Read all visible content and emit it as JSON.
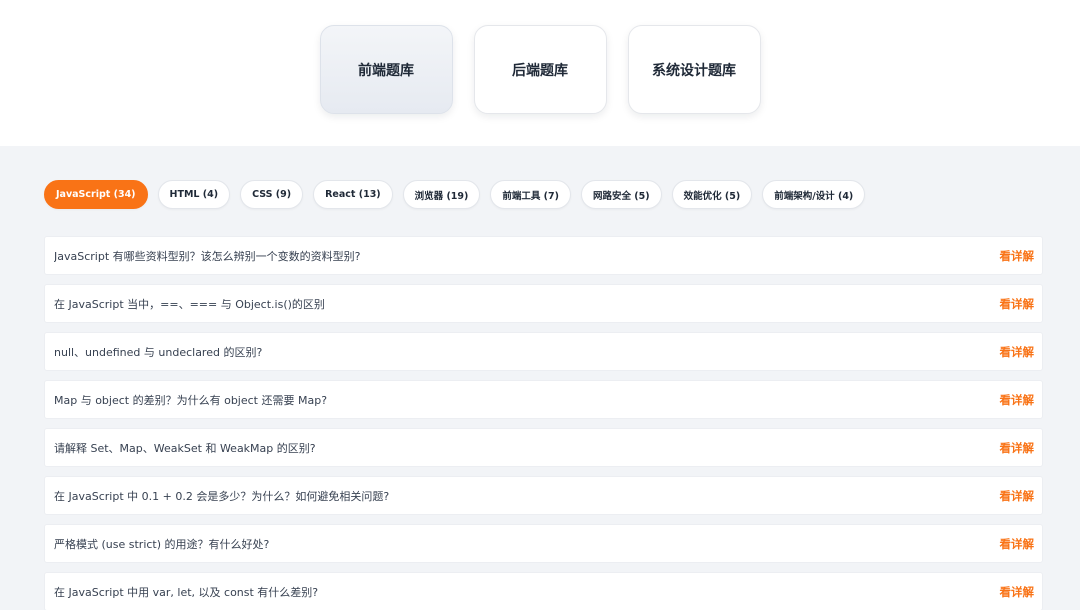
{
  "categories": [
    {
      "label": "前端题库",
      "active": true
    },
    {
      "label": "后端题库",
      "active": false
    },
    {
      "label": "系统设计题库",
      "active": false
    }
  ],
  "tags": [
    {
      "label": "JavaScript (34)",
      "active": true
    },
    {
      "label": "HTML (4)",
      "active": false
    },
    {
      "label": "CSS (9)",
      "active": false
    },
    {
      "label": "React (13)",
      "active": false
    },
    {
      "label": "浏览器 (19)",
      "active": false
    },
    {
      "label": "前端工具 (7)",
      "active": false
    },
    {
      "label": "网路安全 (5)",
      "active": false
    },
    {
      "label": "效能优化 (5)",
      "active": false
    },
    {
      "label": "前端架构/设计 (4)",
      "active": false
    }
  ],
  "questions": [
    {
      "text": "JavaScript 有哪些资料型别？该怎么辨别一个变数的资料型别?",
      "link": "看详解"
    },
    {
      "text": "在 JavaScript 当中，==、=== 与 Object.is()的区别",
      "link": "看详解"
    },
    {
      "text": "null、undefined 与 undeclared 的区别?",
      "link": "看详解"
    },
    {
      "text": "Map 与 object 的差别？为什么有 object 还需要 Map?",
      "link": "看详解"
    },
    {
      "text": "请解释 Set、Map、WeakSet 和 WeakMap 的区别?",
      "link": "看详解"
    },
    {
      "text": "在 JavaScript 中 0.1 + 0.2 会是多少？为什么？如何避免相关问题?",
      "link": "看详解"
    },
    {
      "text": "严格模式 (use strict) 的用途？有什么好处?",
      "link": "看详解"
    },
    {
      "text": "在 JavaScript 中用 var, let, 以及 const 有什么差别?",
      "link": "看详解"
    }
  ],
  "colors": {
    "accent": "#f97316",
    "background": "#f2f4f7"
  }
}
